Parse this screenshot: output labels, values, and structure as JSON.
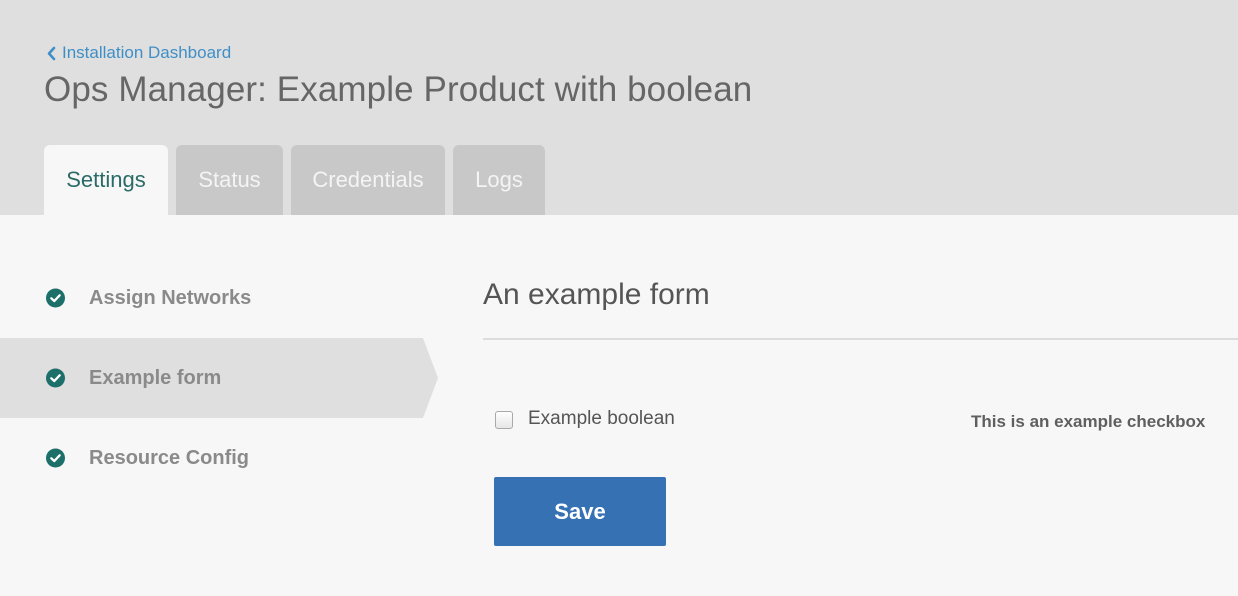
{
  "header": {
    "back_link_label": "Installation Dashboard",
    "title": "Ops Manager: Example Product with boolean"
  },
  "tabs": [
    {
      "label": "Settings",
      "active": true
    },
    {
      "label": "Status",
      "active": false
    },
    {
      "label": "Credentials",
      "active": false
    },
    {
      "label": "Logs",
      "active": false
    }
  ],
  "sidebar": {
    "items": [
      {
        "label": "Assign Networks",
        "status_icon": "check-circle-icon",
        "active": false
      },
      {
        "label": "Example form",
        "status_icon": "check-circle-icon",
        "active": true
      },
      {
        "label": "Resource Config",
        "status_icon": "check-circle-icon",
        "active": false
      }
    ]
  },
  "form": {
    "title": "An example form",
    "checkbox": {
      "label": "Example boolean",
      "checked": false,
      "help_text": "This is an example checkbox"
    },
    "save_label": "Save"
  },
  "colors": {
    "header_bg": "#dfdfdf",
    "link": "#3f8fc7",
    "check_icon": "#1d6f6a",
    "active_tab_text": "#2a6b67",
    "button": "#3671b3",
    "selected_item_bg": "#dfdfdf"
  }
}
